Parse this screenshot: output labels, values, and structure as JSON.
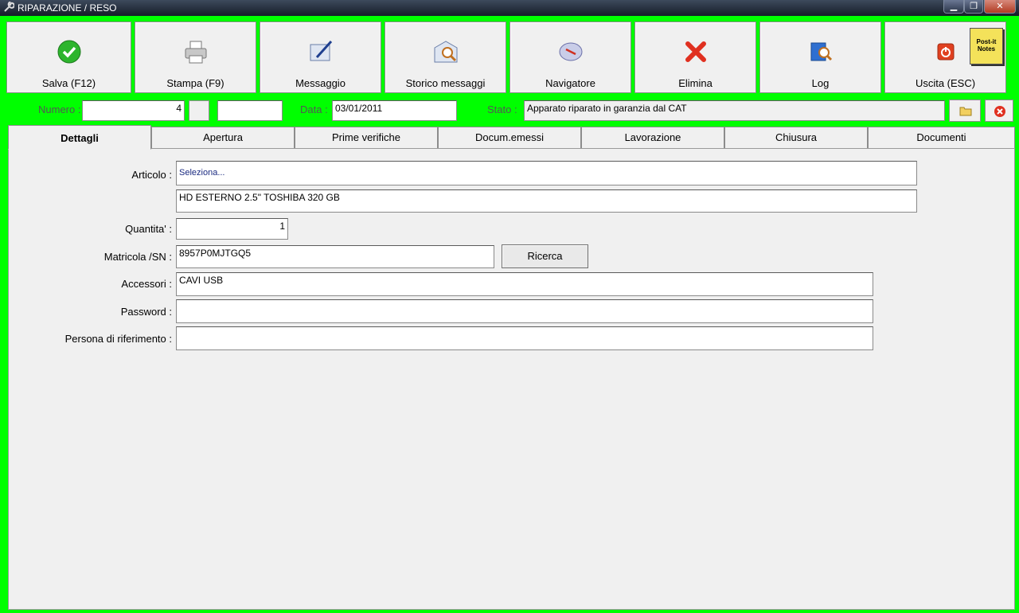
{
  "window": {
    "title": "RIPARAZIONE / RESO"
  },
  "toolbar": {
    "buttons": [
      {
        "label": "Salva (F12)",
        "icon": "check-icon"
      },
      {
        "label": "Stampa (F9)",
        "icon": "printer-icon"
      },
      {
        "label": "Messaggio",
        "icon": "message-pen-icon"
      },
      {
        "label": "Storico messaggi",
        "icon": "message-search-icon"
      },
      {
        "label": "Navigatore",
        "icon": "compass-icon"
      },
      {
        "label": "Elimina",
        "icon": "delete-x-icon"
      },
      {
        "label": "Log",
        "icon": "log-search-icon"
      },
      {
        "label": "Uscita (ESC)",
        "icon": "power-icon"
      }
    ],
    "postit_text": "Post-it Notes"
  },
  "header": {
    "numero_label": "Numero :",
    "numero_value": "4",
    "data_label": "Data :",
    "data_value": "03/01/2011",
    "stato_label": "Stato :",
    "stato_value": "Apparato riparato in garanzia dal CAT"
  },
  "tabs": [
    "Dettagli",
    "Apertura",
    "Prime verifiche",
    "Docum.emessi",
    "Lavorazione",
    "Chiusura",
    "Documenti"
  ],
  "form": {
    "articolo_label": "Articolo :",
    "articolo_select": "Seleziona...",
    "articolo_desc": "HD ESTERNO 2.5\" TOSHIBA 320 GB",
    "quantita_label": "Quantita' :",
    "quantita_value": "1",
    "matricola_label": "Matricola /SN :",
    "matricola_value": "8957P0MJTGQ5",
    "ricerca_label": "Ricerca",
    "accessori_label": "Accessori :",
    "accessori_value": "CAVI USB",
    "password_label": "Password :",
    "password_value": "",
    "persona_label": "Persona di riferimento :",
    "persona_value": ""
  },
  "colors": {
    "background": "#00ff00",
    "accent_check": "#2db52d",
    "accent_delete": "#e03020"
  }
}
